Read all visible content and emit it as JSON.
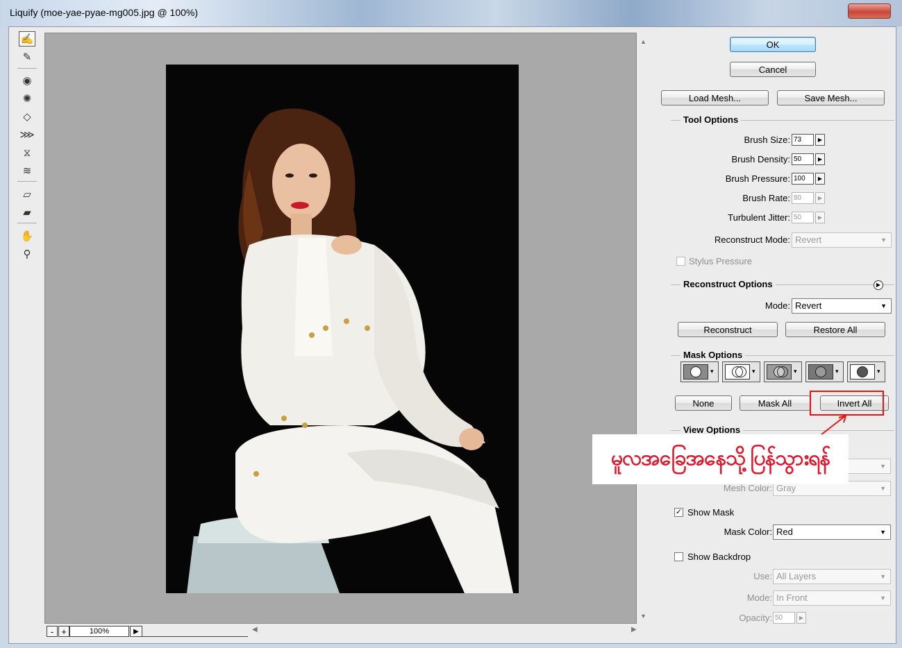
{
  "window": {
    "title": "Liquify (moe-yae-pyae-mg005.jpg @ 100%)"
  },
  "toolbar": {
    "tools": [
      "forward-warp",
      "reconstruct",
      "twirl-clockwise",
      "pucker",
      "bloat",
      "push-left",
      "mirror",
      "turbulence",
      "freeze-mask",
      "thaw-mask",
      "hand",
      "zoom"
    ]
  },
  "status": {
    "zoom": "100%",
    "minus": "-",
    "plus": "+"
  },
  "buttons": {
    "ok": "OK",
    "cancel": "Cancel",
    "load_mesh": "Load Mesh...",
    "save_mesh": "Save Mesh..."
  },
  "tool_options": {
    "title": "Tool Options",
    "brush_size_label": "Brush Size:",
    "brush_size": "73",
    "brush_density_label": "Brush Density:",
    "brush_density": "50",
    "brush_pressure_label": "Brush Pressure:",
    "brush_pressure": "100",
    "brush_rate_label": "Brush Rate:",
    "brush_rate": "80",
    "turbulent_jitter_label": "Turbulent Jitter:",
    "turbulent_jitter": "50",
    "reconstruct_mode_label": "Reconstruct Mode:",
    "reconstruct_mode": "Revert",
    "stylus_pressure_label": "Stylus Pressure"
  },
  "reconstruct_options": {
    "title": "Reconstruct Options",
    "mode_label": "Mode:",
    "mode": "Revert",
    "reconstruct": "Reconstruct",
    "restore_all": "Restore All"
  },
  "mask_options": {
    "title": "Mask Options",
    "none": "None",
    "mask_all": "Mask All",
    "invert_all": "Invert All"
  },
  "view_options": {
    "title": "View Options",
    "mesh_color_label": "Mesh Color:",
    "mesh_color": "Gray",
    "show_mask_label": "Show Mask",
    "show_mask_checked": "✓",
    "mask_color_label": "Mask Color:",
    "mask_color": "Red",
    "show_backdrop_label": "Show Backdrop",
    "use_label": "Use:",
    "use": "All Layers",
    "mode_label": "Mode:",
    "mode": "In Front",
    "opacity_label": "Opacity:",
    "opacity": "50"
  },
  "annotation": {
    "text": "မူလအခြေအနေသို့ပြန်သွားရန်",
    "color": "#e2152a"
  }
}
